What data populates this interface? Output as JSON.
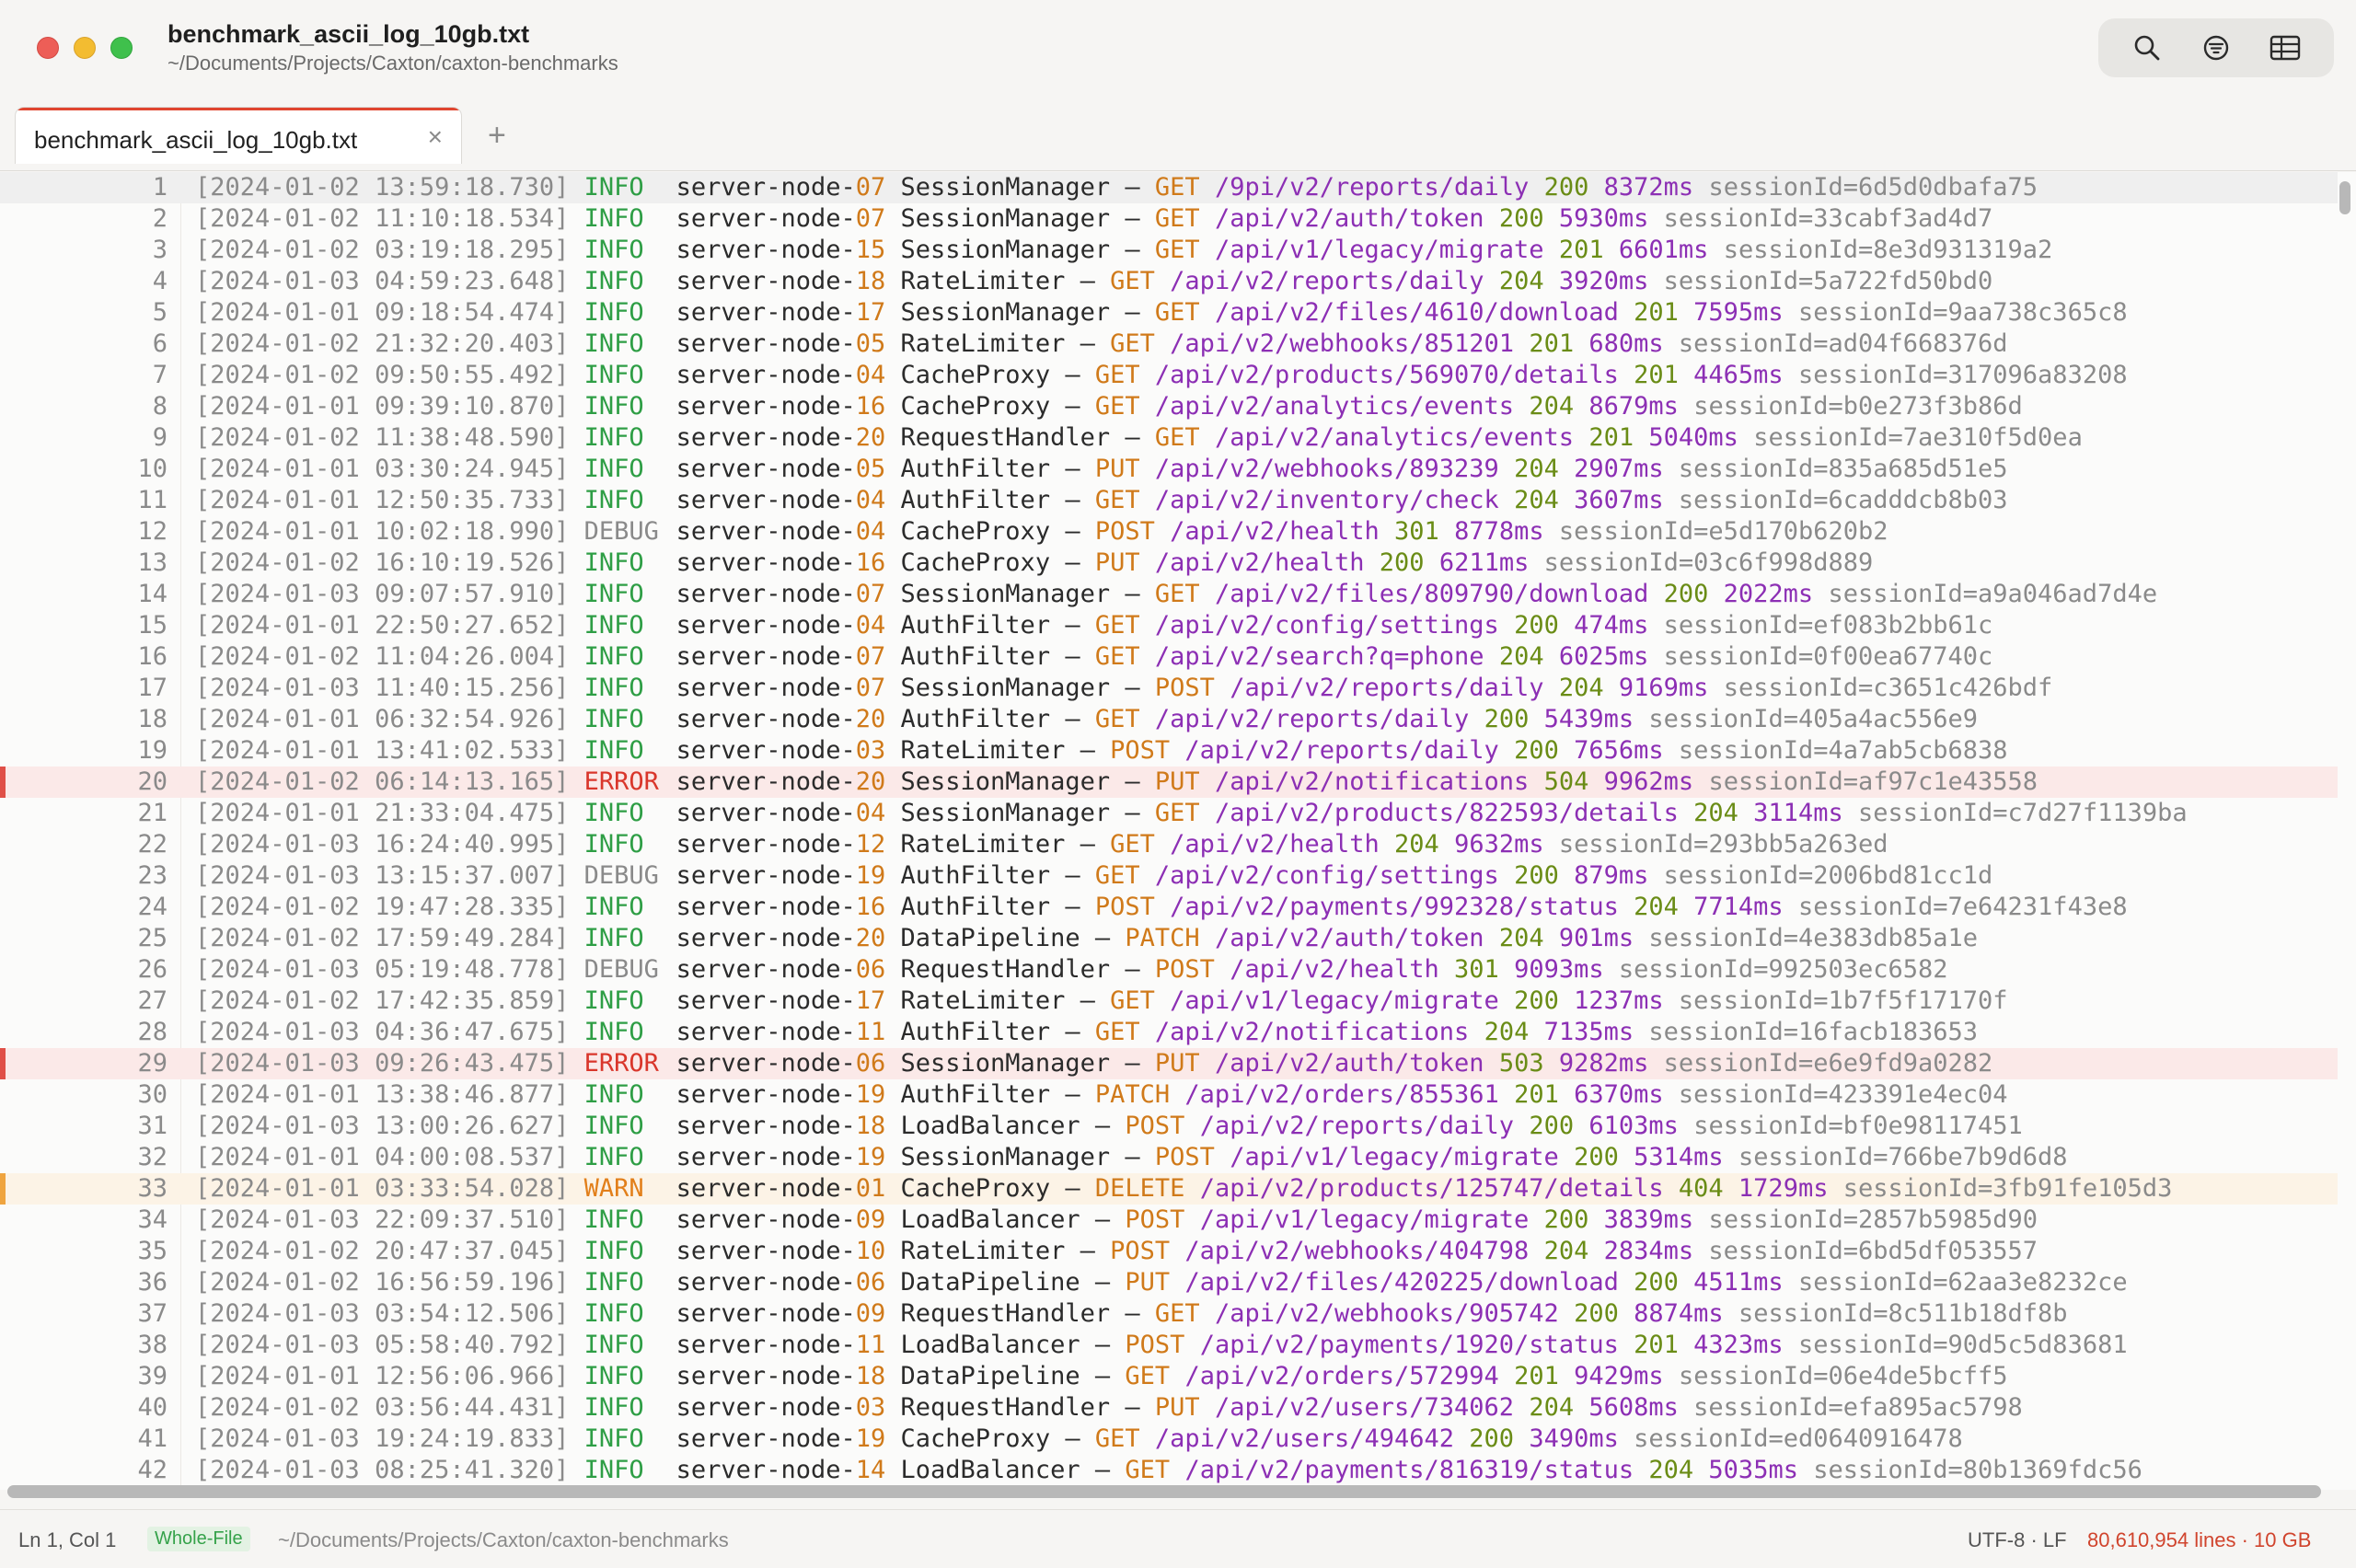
{
  "window": {
    "title": "benchmark_ascii_log_10gb.txt",
    "subtitle": "~/Documents/Projects/Caxton/caxton-benchmarks"
  },
  "toolbar": {
    "icons": [
      "search-icon",
      "filter-icon",
      "table-icon"
    ]
  },
  "tabs": [
    {
      "label": "benchmark_ascii_log_10gb.txt",
      "close": "×"
    }
  ],
  "tab_add": "+",
  "lines": [
    {
      "n": "1",
      "ts": "[2024-01-02 13:59:18.730]",
      "lvl": "INFO",
      "node": "server-node-",
      "nodeno": "07",
      "comp": "SessionManager",
      "method": "GET",
      "path": "/9pi/v2/reports/daily",
      "status": "200",
      "dur": "8372ms",
      "sid": "sessionId=6d5d0dbafa75",
      "kind": "hl"
    },
    {
      "n": "2",
      "ts": "[2024-01-02 11:10:18.534]",
      "lvl": "INFO",
      "node": "server-node-",
      "nodeno": "07",
      "comp": "SessionManager",
      "method": "GET",
      "path": "/api/v2/auth/token",
      "status": "200",
      "dur": "5930ms",
      "sid": "sessionId=33cabf3ad4d7",
      "kind": ""
    },
    {
      "n": "3",
      "ts": "[2024-01-02 03:19:18.295]",
      "lvl": "INFO",
      "node": "server-node-",
      "nodeno": "15",
      "comp": "SessionManager",
      "method": "GET",
      "path": "/api/v1/legacy/migrate",
      "status": "201",
      "dur": "6601ms",
      "sid": "sessionId=8e3d931319a2",
      "kind": ""
    },
    {
      "n": "4",
      "ts": "[2024-01-03 04:59:23.648]",
      "lvl": "INFO",
      "node": "server-node-",
      "nodeno": "18",
      "comp": "RateLimiter",
      "method": "GET",
      "path": "/api/v2/reports/daily",
      "status": "204",
      "dur": "3920ms",
      "sid": "sessionId=5a722fd50bd0",
      "kind": ""
    },
    {
      "n": "5",
      "ts": "[2024-01-01 09:18:54.474]",
      "lvl": "INFO",
      "node": "server-node-",
      "nodeno": "17",
      "comp": "SessionManager",
      "method": "GET",
      "path": "/api/v2/files/4610/download",
      "status": "201",
      "dur": "7595ms",
      "sid": "sessionId=9aa738c365c8",
      "kind": ""
    },
    {
      "n": "6",
      "ts": "[2024-01-02 21:32:20.403]",
      "lvl": "INFO",
      "node": "server-node-",
      "nodeno": "05",
      "comp": "RateLimiter",
      "method": "GET",
      "path": "/api/v2/webhooks/851201",
      "status": "201",
      "dur": "680ms",
      "sid": "sessionId=ad04f668376d",
      "kind": ""
    },
    {
      "n": "7",
      "ts": "[2024-01-02 09:50:55.492]",
      "lvl": "INFO",
      "node": "server-node-",
      "nodeno": "04",
      "comp": "CacheProxy",
      "method": "GET",
      "path": "/api/v2/products/569070/details",
      "status": "201",
      "dur": "4465ms",
      "sid": "sessionId=317096a83208",
      "kind": ""
    },
    {
      "n": "8",
      "ts": "[2024-01-01 09:39:10.870]",
      "lvl": "INFO",
      "node": "server-node-",
      "nodeno": "16",
      "comp": "CacheProxy",
      "method": "GET",
      "path": "/api/v2/analytics/events",
      "status": "204",
      "dur": "8679ms",
      "sid": "sessionId=b0e273f3b86d",
      "kind": ""
    },
    {
      "n": "9",
      "ts": "[2024-01-02 11:38:48.590]",
      "lvl": "INFO",
      "node": "server-node-",
      "nodeno": "20",
      "comp": "RequestHandler",
      "method": "GET",
      "path": "/api/v2/analytics/events",
      "status": "201",
      "dur": "5040ms",
      "sid": "sessionId=7ae310f5d0ea",
      "kind": ""
    },
    {
      "n": "10",
      "ts": "[2024-01-01 03:30:24.945]",
      "lvl": "INFO",
      "node": "server-node-",
      "nodeno": "05",
      "comp": "AuthFilter",
      "method": "PUT",
      "path": "/api/v2/webhooks/893239",
      "status": "204",
      "dur": "2907ms",
      "sid": "sessionId=835a685d51e5",
      "kind": ""
    },
    {
      "n": "11",
      "ts": "[2024-01-01 12:50:35.733]",
      "lvl": "INFO",
      "node": "server-node-",
      "nodeno": "04",
      "comp": "AuthFilter",
      "method": "GET",
      "path": "/api/v2/inventory/check",
      "status": "204",
      "dur": "3607ms",
      "sid": "sessionId=6cadddcb8b03",
      "kind": ""
    },
    {
      "n": "12",
      "ts": "[2024-01-01 10:02:18.990]",
      "lvl": "DEBUG",
      "node": "server-node-",
      "nodeno": "04",
      "comp": "CacheProxy",
      "method": "POST",
      "path": "/api/v2/health",
      "status": "301",
      "dur": "8778ms",
      "sid": "sessionId=e5d170b620b2",
      "kind": ""
    },
    {
      "n": "13",
      "ts": "[2024-01-02 16:10:19.526]",
      "lvl": "INFO",
      "node": "server-node-",
      "nodeno": "16",
      "comp": "CacheProxy",
      "method": "PUT",
      "path": "/api/v2/health",
      "status": "200",
      "dur": "6211ms",
      "sid": "sessionId=03c6f998d889",
      "kind": ""
    },
    {
      "n": "14",
      "ts": "[2024-01-03 09:07:57.910]",
      "lvl": "INFO",
      "node": "server-node-",
      "nodeno": "07",
      "comp": "SessionManager",
      "method": "GET",
      "path": "/api/v2/files/809790/download",
      "status": "200",
      "dur": "2022ms",
      "sid": "sessionId=a9a046ad7d4e",
      "kind": ""
    },
    {
      "n": "15",
      "ts": "[2024-01-01 22:50:27.652]",
      "lvl": "INFO",
      "node": "server-node-",
      "nodeno": "04",
      "comp": "AuthFilter",
      "method": "GET",
      "path": "/api/v2/config/settings",
      "status": "200",
      "dur": "474ms",
      "sid": "sessionId=ef083b2bb61c",
      "kind": ""
    },
    {
      "n": "16",
      "ts": "[2024-01-02 11:04:26.004]",
      "lvl": "INFO",
      "node": "server-node-",
      "nodeno": "07",
      "comp": "AuthFilter",
      "method": "GET",
      "path": "/api/v2/search?q=phone",
      "status": "204",
      "dur": "6025ms",
      "sid": "sessionId=0f00ea67740c",
      "kind": ""
    },
    {
      "n": "17",
      "ts": "[2024-01-03 11:40:15.256]",
      "lvl": "INFO",
      "node": "server-node-",
      "nodeno": "07",
      "comp": "SessionManager",
      "method": "POST",
      "path": "/api/v2/reports/daily",
      "status": "204",
      "dur": "9169ms",
      "sid": "sessionId=c3651c426bdf",
      "kind": ""
    },
    {
      "n": "18",
      "ts": "[2024-01-01 06:32:54.926]",
      "lvl": "INFO",
      "node": "server-node-",
      "nodeno": "20",
      "comp": "AuthFilter",
      "method": "GET",
      "path": "/api/v2/reports/daily",
      "status": "200",
      "dur": "5439ms",
      "sid": "sessionId=405a4ac556e9",
      "kind": ""
    },
    {
      "n": "19",
      "ts": "[2024-01-01 13:41:02.533]",
      "lvl": "INFO",
      "node": "server-node-",
      "nodeno": "03",
      "comp": "RateLimiter",
      "method": "POST",
      "path": "/api/v2/reports/daily",
      "status": "200",
      "dur": "7656ms",
      "sid": "sessionId=4a7ab5cb6838",
      "kind": ""
    },
    {
      "n": "20",
      "ts": "[2024-01-02 06:14:13.165]",
      "lvl": "ERROR",
      "node": "server-node-",
      "nodeno": "20",
      "comp": "SessionManager",
      "method": "PUT",
      "path": "/api/v2/notifications",
      "status": "504",
      "dur": "9962ms",
      "sid": "sessionId=af97c1e43558",
      "kind": "error"
    },
    {
      "n": "21",
      "ts": "[2024-01-01 21:33:04.475]",
      "lvl": "INFO",
      "node": "server-node-",
      "nodeno": "04",
      "comp": "SessionManager",
      "method": "GET",
      "path": "/api/v2/products/822593/details",
      "status": "204",
      "dur": "3114ms",
      "sid": "sessionId=c7d27f1139ba",
      "kind": ""
    },
    {
      "n": "22",
      "ts": "[2024-01-03 16:24:40.995]",
      "lvl": "INFO",
      "node": "server-node-",
      "nodeno": "12",
      "comp": "RateLimiter",
      "method": "GET",
      "path": "/api/v2/health",
      "status": "204",
      "dur": "9632ms",
      "sid": "sessionId=293bb5a263ed",
      "kind": ""
    },
    {
      "n": "23",
      "ts": "[2024-01-03 13:15:37.007]",
      "lvl": "DEBUG",
      "node": "server-node-",
      "nodeno": "19",
      "comp": "AuthFilter",
      "method": "GET",
      "path": "/api/v2/config/settings",
      "status": "200",
      "dur": "879ms",
      "sid": "sessionId=2006bd81cc1d",
      "kind": ""
    },
    {
      "n": "24",
      "ts": "[2024-01-02 19:47:28.335]",
      "lvl": "INFO",
      "node": "server-node-",
      "nodeno": "16",
      "comp": "AuthFilter",
      "method": "POST",
      "path": "/api/v2/payments/992328/status",
      "status": "204",
      "dur": "7714ms",
      "sid": "sessionId=7e64231f43e8",
      "kind": ""
    },
    {
      "n": "25",
      "ts": "[2024-01-02 17:59:49.284]",
      "lvl": "INFO",
      "node": "server-node-",
      "nodeno": "20",
      "comp": "DataPipeline",
      "method": "PATCH",
      "path": "/api/v2/auth/token",
      "status": "204",
      "dur": "901ms",
      "sid": "sessionId=4e383db85a1e",
      "kind": ""
    },
    {
      "n": "26",
      "ts": "[2024-01-03 05:19:48.778]",
      "lvl": "DEBUG",
      "node": "server-node-",
      "nodeno": "06",
      "comp": "RequestHandler",
      "method": "POST",
      "path": "/api/v2/health",
      "status": "301",
      "dur": "9093ms",
      "sid": "sessionId=992503ec6582",
      "kind": ""
    },
    {
      "n": "27",
      "ts": "[2024-01-02 17:42:35.859]",
      "lvl": "INFO",
      "node": "server-node-",
      "nodeno": "17",
      "comp": "RateLimiter",
      "method": "GET",
      "path": "/api/v1/legacy/migrate",
      "status": "200",
      "dur": "1237ms",
      "sid": "sessionId=1b7f5f17170f",
      "kind": ""
    },
    {
      "n": "28",
      "ts": "[2024-01-03 04:36:47.675]",
      "lvl": "INFO",
      "node": "server-node-",
      "nodeno": "11",
      "comp": "AuthFilter",
      "method": "GET",
      "path": "/api/v2/notifications",
      "status": "204",
      "dur": "7135ms",
      "sid": "sessionId=16facb183653",
      "kind": ""
    },
    {
      "n": "29",
      "ts": "[2024-01-03 09:26:43.475]",
      "lvl": "ERROR",
      "node": "server-node-",
      "nodeno": "06",
      "comp": "SessionManager",
      "method": "PUT",
      "path": "/api/v2/auth/token",
      "status": "503",
      "dur": "9282ms",
      "sid": "sessionId=e6e9fd9a0282",
      "kind": "error"
    },
    {
      "n": "30",
      "ts": "[2024-01-01 13:38:46.877]",
      "lvl": "INFO",
      "node": "server-node-",
      "nodeno": "19",
      "comp": "AuthFilter",
      "method": "PATCH",
      "path": "/api/v2/orders/855361",
      "status": "201",
      "dur": "6370ms",
      "sid": "sessionId=423391e4ec04",
      "kind": ""
    },
    {
      "n": "31",
      "ts": "[2024-01-03 13:00:26.627]",
      "lvl": "INFO",
      "node": "server-node-",
      "nodeno": "18",
      "comp": "LoadBalancer",
      "method": "POST",
      "path": "/api/v2/reports/daily",
      "status": "200",
      "dur": "6103ms",
      "sid": "sessionId=bf0e98117451",
      "kind": ""
    },
    {
      "n": "32",
      "ts": "[2024-01-01 04:00:08.537]",
      "lvl": "INFO",
      "node": "server-node-",
      "nodeno": "19",
      "comp": "SessionManager",
      "method": "POST",
      "path": "/api/v1/legacy/migrate",
      "status": "200",
      "dur": "5314ms",
      "sid": "sessionId=766be7b9d6d8",
      "kind": ""
    },
    {
      "n": "33",
      "ts": "[2024-01-01 03:33:54.028]",
      "lvl": "WARN",
      "node": "server-node-",
      "nodeno": "01",
      "comp": "CacheProxy",
      "method": "DELETE",
      "path": "/api/v2/products/125747/details",
      "status": "404",
      "dur": "1729ms",
      "sid": "sessionId=3fb91fe105d3",
      "kind": "warn"
    },
    {
      "n": "34",
      "ts": "[2024-01-03 22:09:37.510]",
      "lvl": "INFO",
      "node": "server-node-",
      "nodeno": "09",
      "comp": "LoadBalancer",
      "method": "POST",
      "path": "/api/v1/legacy/migrate",
      "status": "200",
      "dur": "3839ms",
      "sid": "sessionId=2857b5985d90",
      "kind": ""
    },
    {
      "n": "35",
      "ts": "[2024-01-02 20:47:37.045]",
      "lvl": "INFO",
      "node": "server-node-",
      "nodeno": "10",
      "comp": "RateLimiter",
      "method": "POST",
      "path": "/api/v2/webhooks/404798",
      "status": "204",
      "dur": "2834ms",
      "sid": "sessionId=6bd5df053557",
      "kind": ""
    },
    {
      "n": "36",
      "ts": "[2024-01-02 16:56:59.196]",
      "lvl": "INFO",
      "node": "server-node-",
      "nodeno": "06",
      "comp": "DataPipeline",
      "method": "PUT",
      "path": "/api/v2/files/420225/download",
      "status": "200",
      "dur": "4511ms",
      "sid": "sessionId=62aa3e8232ce",
      "kind": ""
    },
    {
      "n": "37",
      "ts": "[2024-01-03 03:54:12.506]",
      "lvl": "INFO",
      "node": "server-node-",
      "nodeno": "09",
      "comp": "RequestHandler",
      "method": "GET",
      "path": "/api/v2/webhooks/905742",
      "status": "200",
      "dur": "8874ms",
      "sid": "sessionId=8c511b18df8b",
      "kind": ""
    },
    {
      "n": "38",
      "ts": "[2024-01-03 05:58:40.792]",
      "lvl": "INFO",
      "node": "server-node-",
      "nodeno": "11",
      "comp": "LoadBalancer",
      "method": "POST",
      "path": "/api/v2/payments/1920/status",
      "status": "201",
      "dur": "4323ms",
      "sid": "sessionId=90d5c5d83681",
      "kind": ""
    },
    {
      "n": "39",
      "ts": "[2024-01-01 12:56:06.966]",
      "lvl": "INFO",
      "node": "server-node-",
      "nodeno": "18",
      "comp": "DataPipeline",
      "method": "GET",
      "path": "/api/v2/orders/572994",
      "status": "201",
      "dur": "9429ms",
      "sid": "sessionId=06e4de5bcff5",
      "kind": ""
    },
    {
      "n": "40",
      "ts": "[2024-01-02 03:56:44.431]",
      "lvl": "INFO",
      "node": "server-node-",
      "nodeno": "03",
      "comp": "RequestHandler",
      "method": "PUT",
      "path": "/api/v2/users/734062",
      "status": "204",
      "dur": "5608ms",
      "sid": "sessionId=efa895ac5798",
      "kind": ""
    },
    {
      "n": "41",
      "ts": "[2024-01-03 19:24:19.833]",
      "lvl": "INFO",
      "node": "server-node-",
      "nodeno": "19",
      "comp": "CacheProxy",
      "method": "GET",
      "path": "/api/v2/users/494642",
      "status": "200",
      "dur": "3490ms",
      "sid": "sessionId=ed0640916478",
      "kind": ""
    },
    {
      "n": "42",
      "ts": "[2024-01-03 08:25:41.320]",
      "lvl": "INFO",
      "node": "server-node-",
      "nodeno": "14",
      "comp": "LoadBalancer",
      "method": "GET",
      "path": "/api/v2/payments/816319/status",
      "status": "204",
      "dur": "5035ms",
      "sid": "sessionId=80b1369fdc56",
      "kind": ""
    }
  ],
  "statusbar": {
    "position": "Ln 1, Col 1",
    "mode": "Whole-File",
    "path": "~/Documents/Projects/Caxton/caxton-benchmarks",
    "encoding": "UTF-8 · LF",
    "line_count": "80,610,954 lines · 10 GB"
  }
}
